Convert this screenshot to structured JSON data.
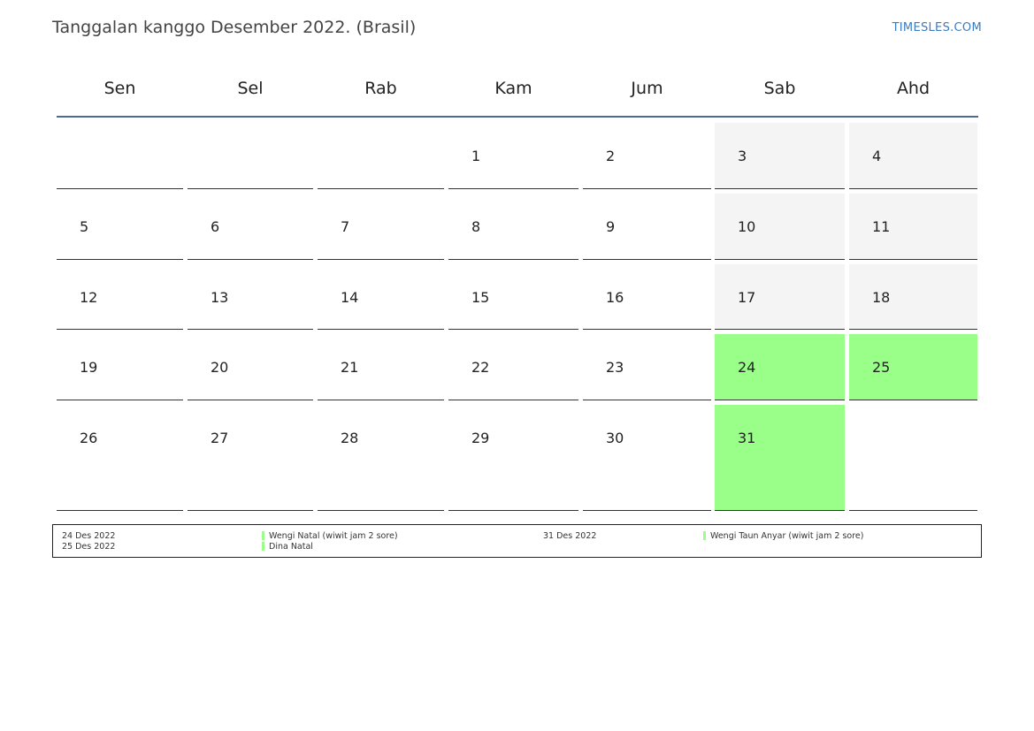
{
  "header": {
    "title": "Tanggalan kanggo Desember 2022. (Brasil)",
    "brand": "TIMESLES.COM"
  },
  "colors": {
    "holiday": "#99ff88",
    "weekend": "#f4f4f4",
    "header_line": "#4f6a8f",
    "brand": "#3a7cc0"
  },
  "calendar": {
    "weekdays": [
      "Sen",
      "Sel",
      "Rab",
      "Kam",
      "Jum",
      "Sab",
      "Ahd"
    ],
    "weeks": [
      [
        "",
        "",
        "",
        "1",
        "2",
        "3",
        "4"
      ],
      [
        "5",
        "6",
        "7",
        "8",
        "9",
        "10",
        "11"
      ],
      [
        "12",
        "13",
        "14",
        "15",
        "16",
        "17",
        "18"
      ],
      [
        "19",
        "20",
        "21",
        "22",
        "23",
        "24",
        "25"
      ],
      [
        "26",
        "27",
        "28",
        "29",
        "30",
        "31",
        ""
      ]
    ],
    "holiday_days": [
      "24",
      "25",
      "31"
    ]
  },
  "legend": {
    "left": [
      {
        "date": "24 Des 2022",
        "name": "Wengi Natal (wiwit jam 2 sore)"
      },
      {
        "date": "25 Des 2022",
        "name": "Dina Natal"
      }
    ],
    "right": [
      {
        "date": "31 Des 2022",
        "name": "Wengi Taun Anyar (wiwit jam 2 sore)"
      }
    ]
  }
}
